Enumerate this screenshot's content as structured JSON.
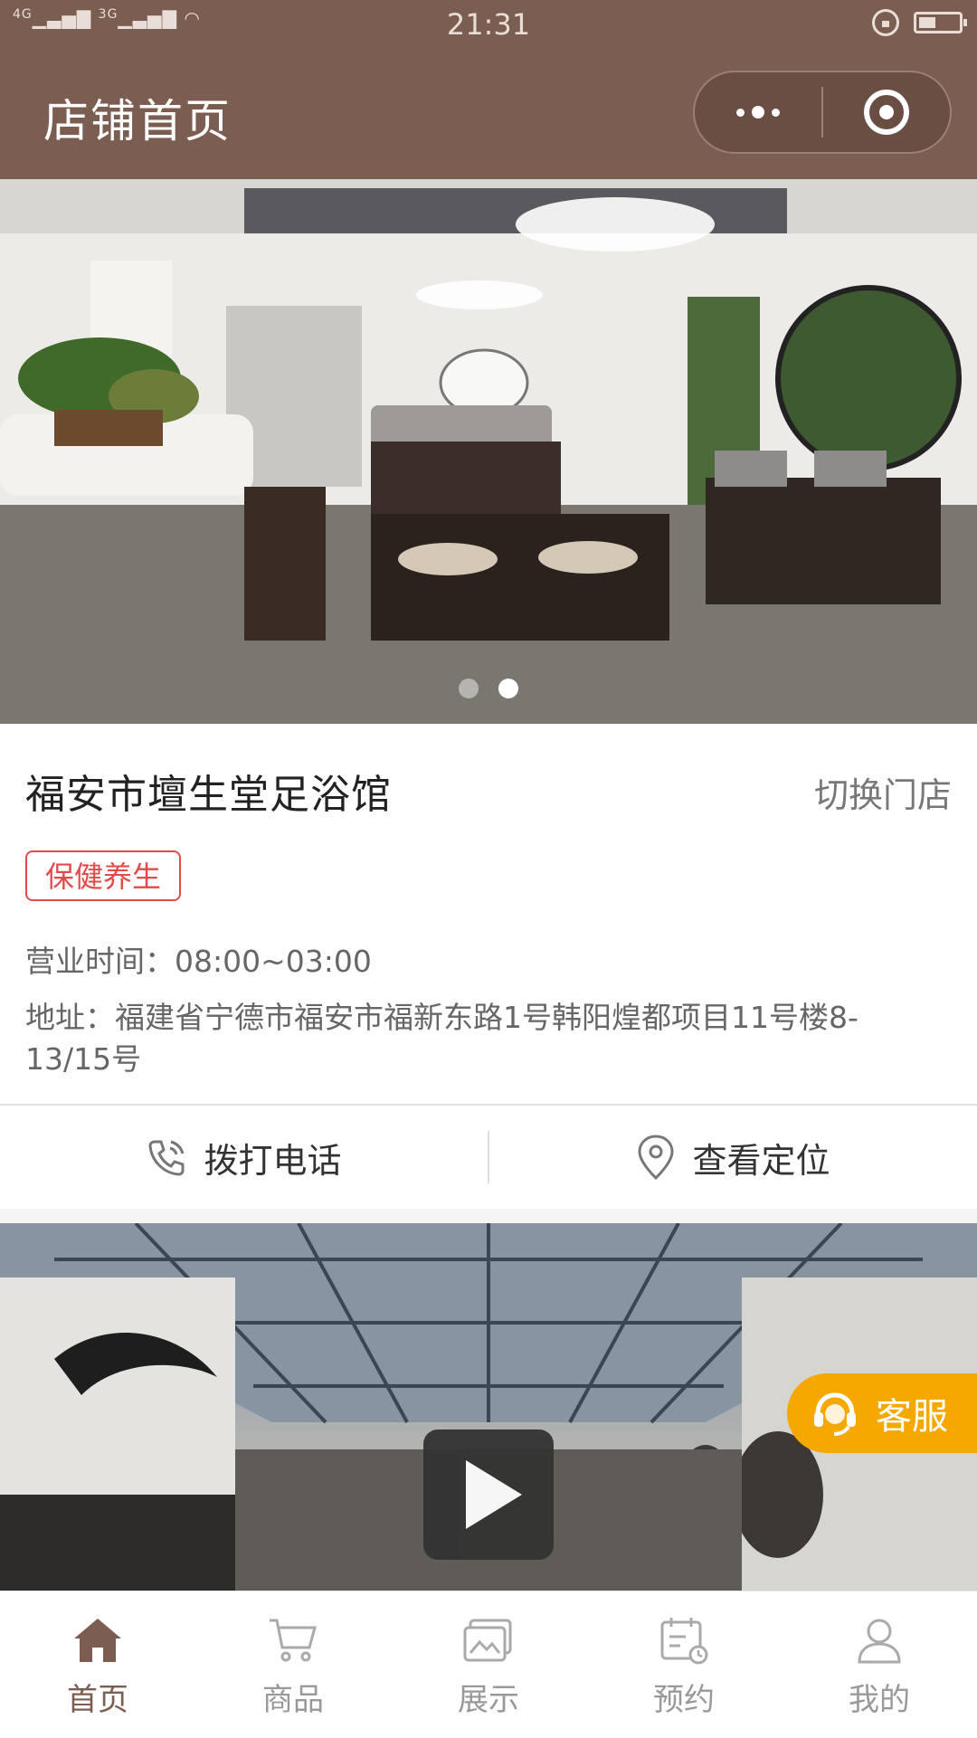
{
  "status_bar": {
    "network_1": "4G",
    "network_2": "3G",
    "time": "21:31"
  },
  "header": {
    "title": "店铺首页",
    "menu_icon": "more-dots-icon",
    "close_icon": "target-circle-icon"
  },
  "banner": {
    "slides": 2,
    "active_index": 1
  },
  "store": {
    "name": "福安市壇生堂足浴馆",
    "switch_label": "切换门店",
    "tag": "保健养生",
    "hours": "营业时间：08:00~03:00",
    "address": "地址：福建省宁德市福安市福新东路1号韩阳煌都项目11号楼8-13/15号"
  },
  "actions": {
    "call_label": "拨打电话",
    "location_label": "查看定位"
  },
  "service": {
    "label": "客服"
  },
  "tabs": [
    {
      "label": "首页",
      "icon": "home-icon",
      "active": true
    },
    {
      "label": "商品",
      "icon": "cart-icon",
      "active": false
    },
    {
      "label": "展示",
      "icon": "gallery-icon",
      "active": false
    },
    {
      "label": "预约",
      "icon": "calendar-icon",
      "active": false
    },
    {
      "label": "我的",
      "icon": "user-icon",
      "active": false
    }
  ],
  "colors": {
    "brand": "#7b5d51",
    "tag_red": "#e24a4a",
    "service_orange": "#f5a800"
  }
}
